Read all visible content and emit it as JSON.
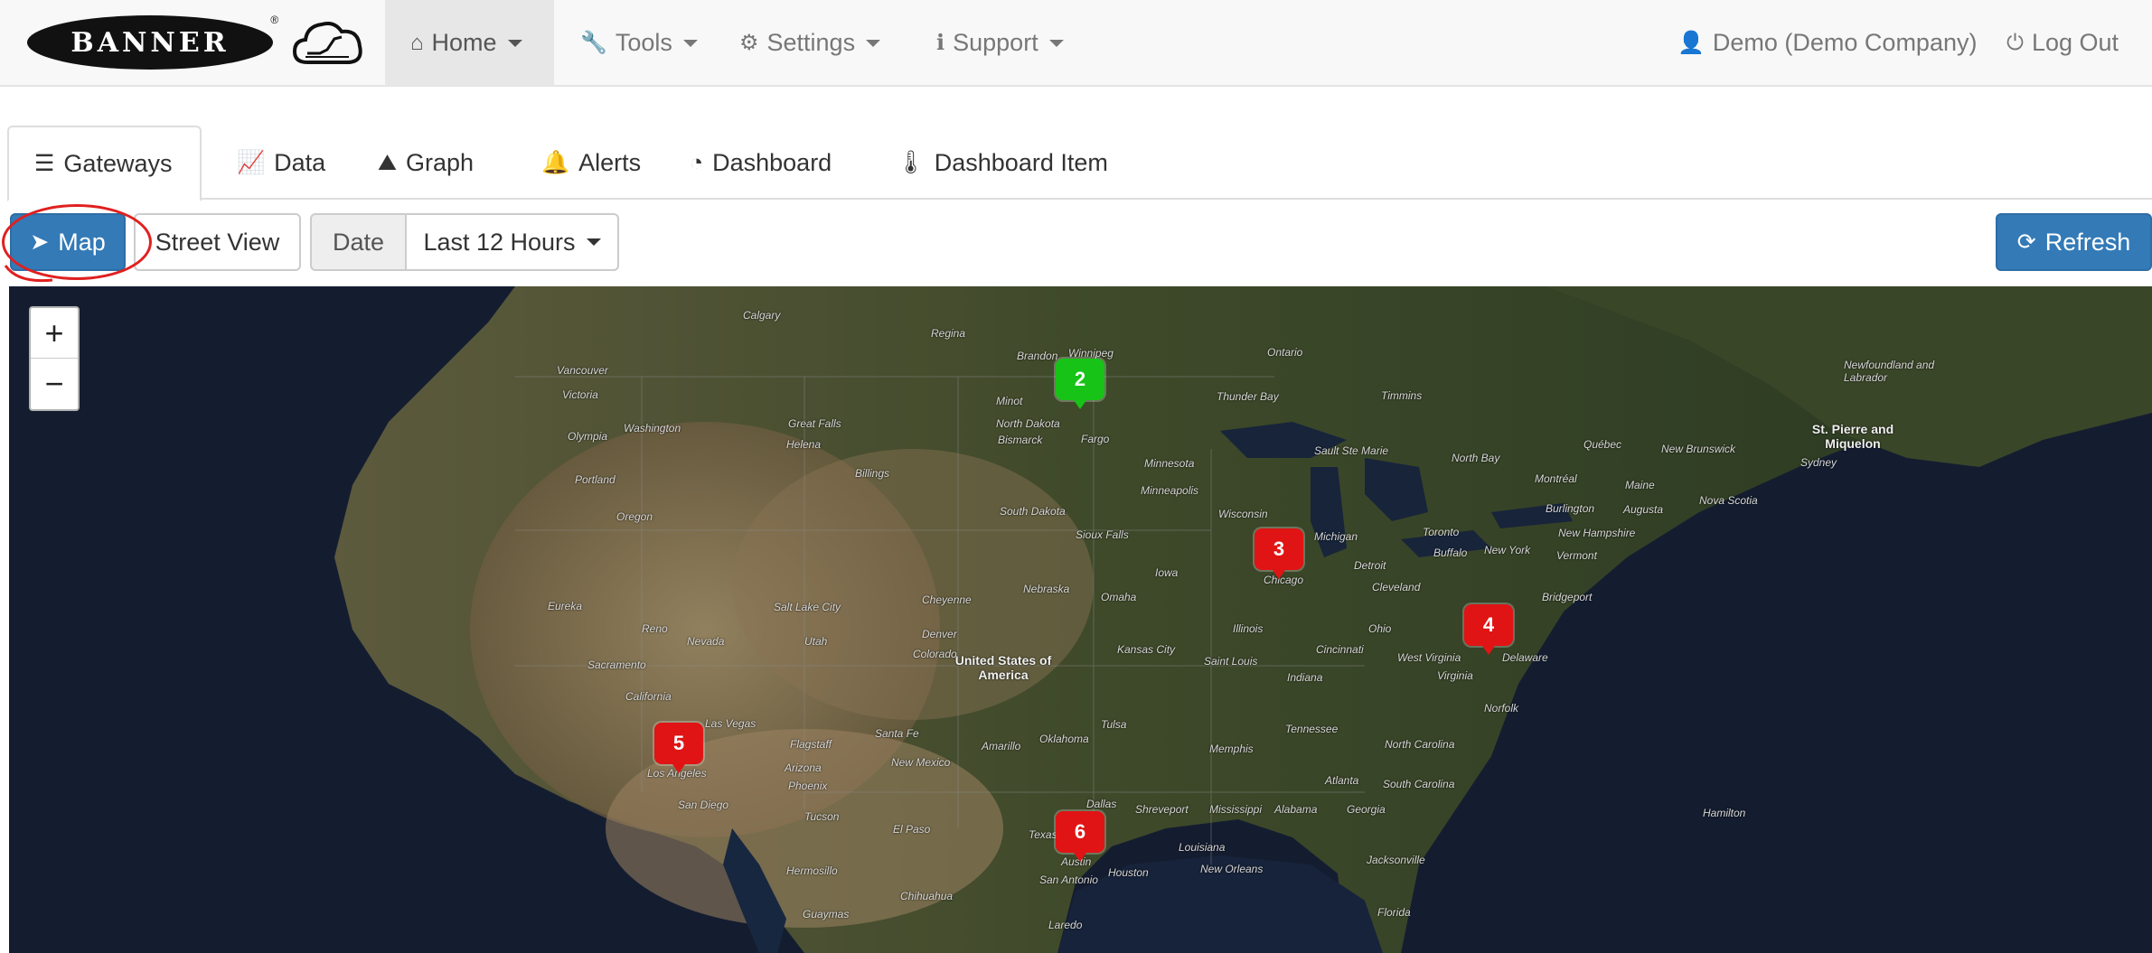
{
  "navbar": {
    "brand_text": "BANNER",
    "items": [
      {
        "label": "Home",
        "icon": "home-icon",
        "glyph": "⌂"
      },
      {
        "label": "Tools",
        "icon": "wrench-icon",
        "glyph": "🔧"
      },
      {
        "label": "Settings",
        "icon": "cogs-icon",
        "glyph": "⚙"
      },
      {
        "label": "Support",
        "icon": "info-icon",
        "glyph": "ℹ"
      }
    ],
    "user": {
      "label": "Demo (Demo Company)",
      "glyph": "👤"
    },
    "logout": {
      "label": "Log Out",
      "glyph": "⏻"
    }
  },
  "tabs": [
    {
      "label": "Gateways",
      "glyph": "☰"
    },
    {
      "label": "Data",
      "glyph": "📈"
    },
    {
      "label": "Graph",
      "glyph": "⛰"
    },
    {
      "label": "Alerts",
      "glyph": "🔔"
    },
    {
      "label": "Dashboard",
      "glyph": "◔"
    },
    {
      "label": "Dashboard Item",
      "glyph": "🌡"
    }
  ],
  "toolbar": {
    "map_label": "Map",
    "map_glyph": "➤",
    "street_view_label": "Street View",
    "date_label": "Date",
    "date_value": "Last 12 Hours",
    "refresh_label": "Refresh",
    "refresh_glyph": "⟳"
  },
  "map": {
    "zoom_in": "+",
    "zoom_out": "−",
    "markers": [
      {
        "count": "2",
        "status": "green"
      },
      {
        "count": "3",
        "status": "red"
      },
      {
        "count": "4",
        "status": "red"
      },
      {
        "count": "5",
        "status": "red"
      },
      {
        "count": "6",
        "status": "red"
      }
    ],
    "labels": {
      "country": "United States of America",
      "st_pierre": "St. Pierre and Miquelon",
      "newfoundland": "Newfoundland and Labrador",
      "calgary": "Calgary",
      "regina": "Regina",
      "winnipeg": "Winnipeg",
      "brandon": "Brandon",
      "vancouver": "Vancouver",
      "victoria": "Victoria",
      "ontario": "Ontario",
      "thunder_bay": "Thunder Bay",
      "timmins": "Timmins",
      "minot": "Minot",
      "north_dakota": "North Dakota",
      "bismarck": "Bismarck",
      "fargo": "Fargo",
      "great_falls": "Great Falls",
      "helena": "Helena",
      "olympia": "Olympia",
      "washington": "Washington",
      "portland": "Portland",
      "oregon": "Oregon",
      "billings": "Billings",
      "minnesota": "Minnesota",
      "minneapolis": "Minneapolis",
      "sault": "Sault Ste Marie",
      "north_bay": "North Bay",
      "quebec": "Québec",
      "new_brunswick": "New Brunswick",
      "sydney": "Sydney",
      "montreal": "Montréal",
      "maine": "Maine",
      "augusta": "Augusta",
      "burlington": "Burlington",
      "nova_scotia": "Nova Scotia",
      "new_hampshire": "New Hampshire",
      "vermont": "Vermont",
      "toronto": "Toronto",
      "buffalo": "Buffalo",
      "new_york": "New York",
      "michigan": "Michigan",
      "wisconsin": "Wisconsin",
      "south_dakota": "South Dakota",
      "sioux_falls": "Sioux Falls",
      "detroit": "Detroit",
      "cleveland": "Cleveland",
      "chicago": "Chicago",
      "iowa": "Iowa",
      "nebraska": "Nebraska",
      "omaha": "Omaha",
      "bridgeport": "Bridgeport",
      "eureka": "Eureka",
      "salt_lake": "Salt Lake City",
      "cheyenne": "Cheyenne",
      "reno": "Reno",
      "nevada": "Nevada",
      "utah": "Utah",
      "denver": "Denver",
      "colorado": "Colorado",
      "sacramento": "Sacramento",
      "california": "California",
      "kansas_city": "Kansas City",
      "illinois": "Illinois",
      "st_louis": "Saint Louis",
      "indiana": "Indiana",
      "ohio": "Ohio",
      "cincinnati": "Cincinnati",
      "west_virginia": "West Virginia",
      "virginia": "Virginia",
      "delaware": "Delaware",
      "norfolk": "Norfolk",
      "las_vegas": "Las Vegas",
      "santa_fe": "Santa Fe",
      "tulsa": "Tulsa",
      "flagstaff": "Flagstaff",
      "arizona": "Arizona",
      "oklahoma": "Oklahoma",
      "amarillo": "Amarillo",
      "new_mexico": "New Mexico",
      "phoenix": "Phoenix",
      "memphis": "Memphis",
      "tennessee": "Tennessee",
      "north_carolina": "North Carolina",
      "los_angeles": "Los Angeles",
      "san_diego": "San Diego",
      "tucson": "Tucson",
      "el_paso": "El Paso",
      "dallas": "Dallas",
      "shreveport": "Shreveport",
      "mississippi": "Mississippi",
      "alabama": "Alabama",
      "atlanta": "Atlanta",
      "georgia": "Georgia",
      "south_carolina": "South Carolina",
      "texas": "Texas",
      "louisiana": "Louisiana",
      "houston": "Houston",
      "austin": "Austin",
      "san_antonio": "San Antonio",
      "new_orleans": "New Orleans",
      "jacksonville": "Jacksonville",
      "florida": "Florida",
      "hamilton": "Hamilton",
      "chihuahua": "Chihuahua",
      "hermosillo": "Hermosillo",
      "guaymas": "Guaymas",
      "laredo": "Laredo"
    }
  }
}
